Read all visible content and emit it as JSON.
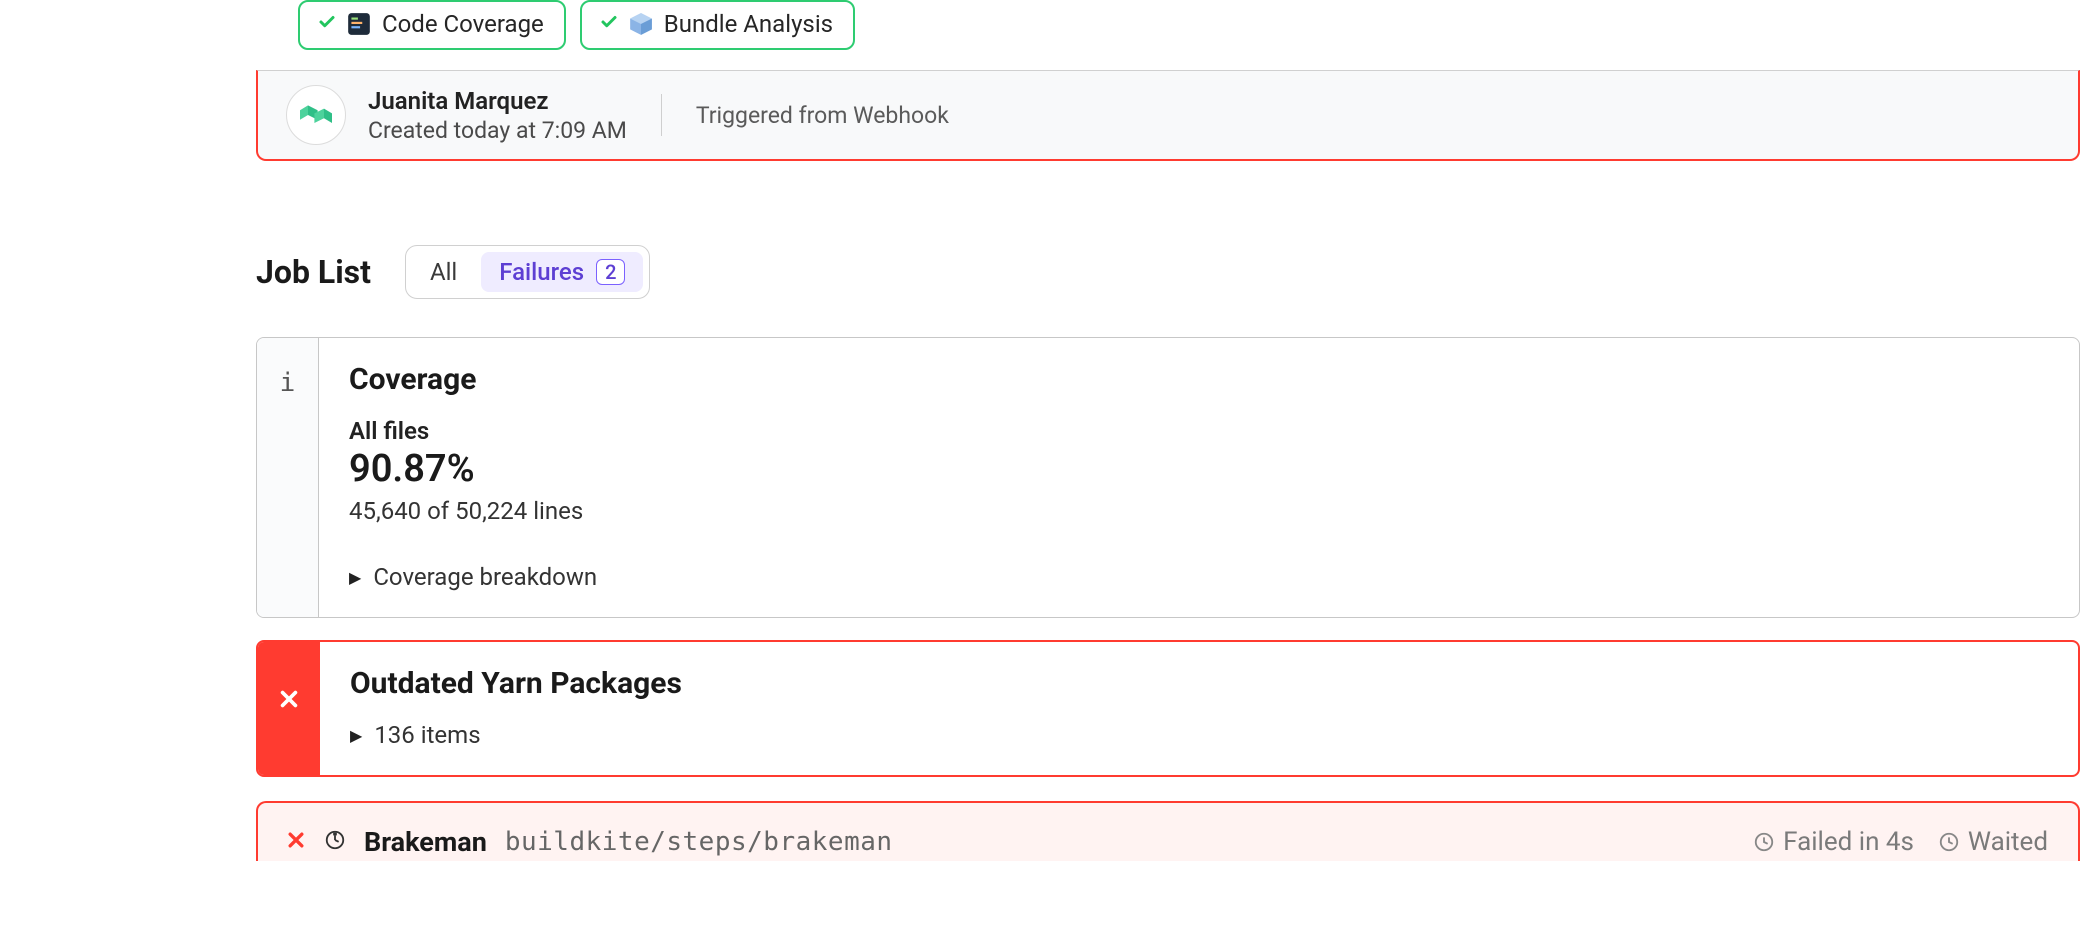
{
  "steps": [
    {
      "label": "Code Coverage",
      "icon": "code-coverage"
    },
    {
      "label": "Bundle Analysis",
      "icon": "bundle"
    }
  ],
  "build": {
    "author": "Juanita Marquez",
    "created": "Created today at 7:09 AM",
    "trigger": "Triggered from Webhook"
  },
  "job_list": {
    "title": "Job List",
    "filters": {
      "all": "All",
      "failures": "Failures",
      "failures_count": "2"
    }
  },
  "coverage": {
    "title": "Coverage",
    "sub": "All files",
    "pct": "90.87%",
    "lines": "45,640 of 50,224 lines",
    "breakdown_label": "Coverage breakdown"
  },
  "yarn": {
    "title": "Outdated Yarn Packages",
    "items_label": "136 items"
  },
  "brakeman": {
    "name": "Brakeman",
    "path": "buildkite/steps/brakeman",
    "failed": "Failed in 4s",
    "waited": "Waited"
  }
}
